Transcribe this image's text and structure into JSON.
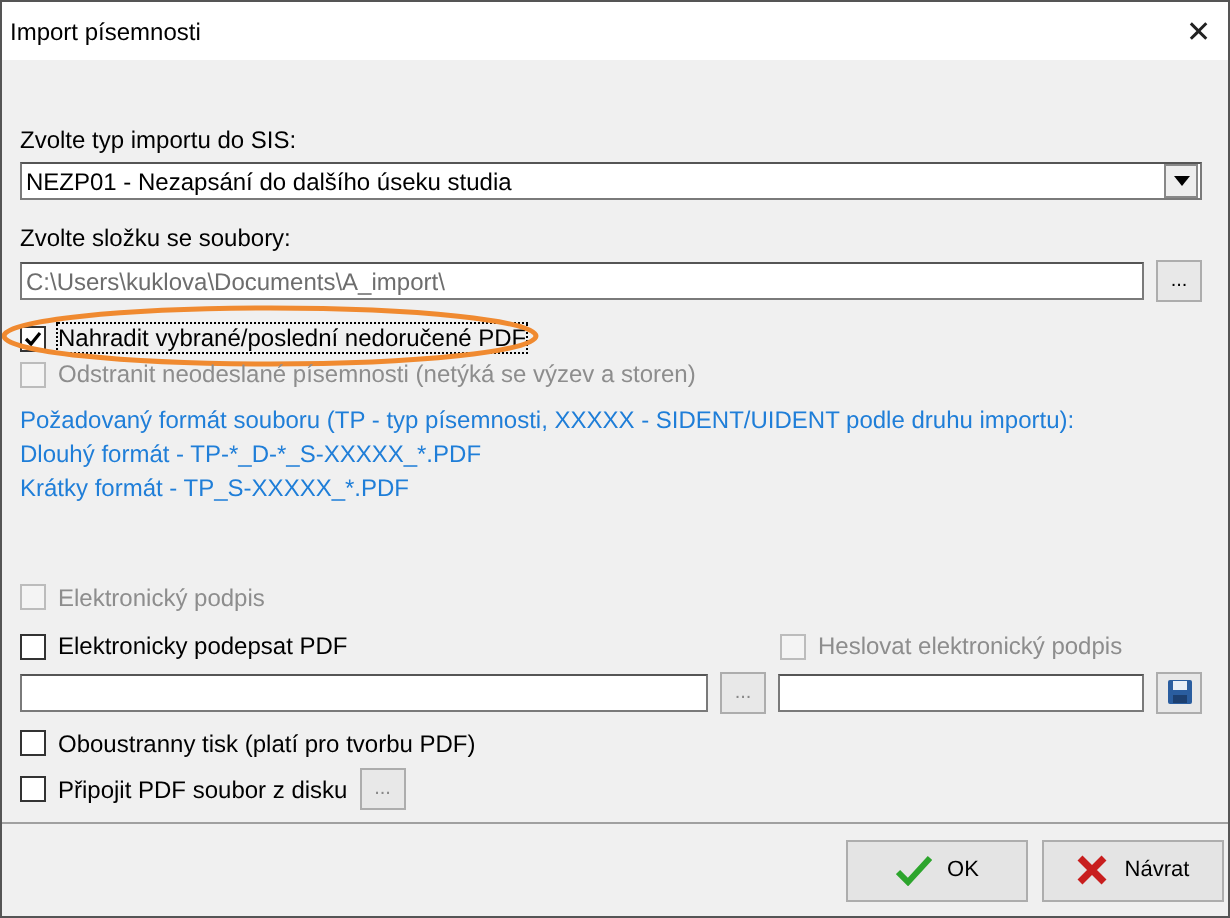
{
  "window": {
    "title": "Import písemnosti",
    "close": "✕"
  },
  "import_type": {
    "label": "Zvolte typ importu do SIS:",
    "value": "NEZP01 - Nezapsání do dalšího úseku studia"
  },
  "folder": {
    "label": "Zvolte složku se soubory:",
    "value": "C:\\Users\\kuklova\\Documents\\A_import\\",
    "browse": "..."
  },
  "options_top": [
    {
      "label": "Nahradit vybrané/poslední nedoručené PDF",
      "checked": true,
      "disabled": false,
      "highlighted": true
    },
    {
      "label": "Odstranit neodeslané písemnosti (netýká se výzev a storen)",
      "checked": false,
      "disabled": true,
      "highlighted": false
    }
  ],
  "format_info": [
    "Požadovaný formát souboru (TP - typ písemnosti, XXXXX - SIDENT/UIDENT podle druhu importu):",
    "Dlouhý formát -  TP-*_D-*_S-XXXXX_*.PDF",
    "Krátky formát -  TP_S-XXXXX_*.PDF"
  ],
  "signature": {
    "label": "Elektronický podpis",
    "checked": false,
    "disabled": true
  },
  "sign_pdf": {
    "label": "Elektronicky podepsat PDF",
    "checked": false,
    "disabled": false
  },
  "password_sign": {
    "label": "Heslovat elektronický podpis",
    "checked": false,
    "disabled": true
  },
  "cert_browse": "...",
  "duplex": {
    "label": "Oboustranny tisk (platí pro tvorbu PDF)",
    "checked": false,
    "disabled": false
  },
  "attach": {
    "label": "Připojit PDF soubor z disku",
    "checked": false,
    "disabled": false,
    "browse": "..."
  },
  "buttons": [
    {
      "label": "OK",
      "kind": "ok"
    },
    {
      "label": "Návrat",
      "kind": "cancel"
    }
  ]
}
